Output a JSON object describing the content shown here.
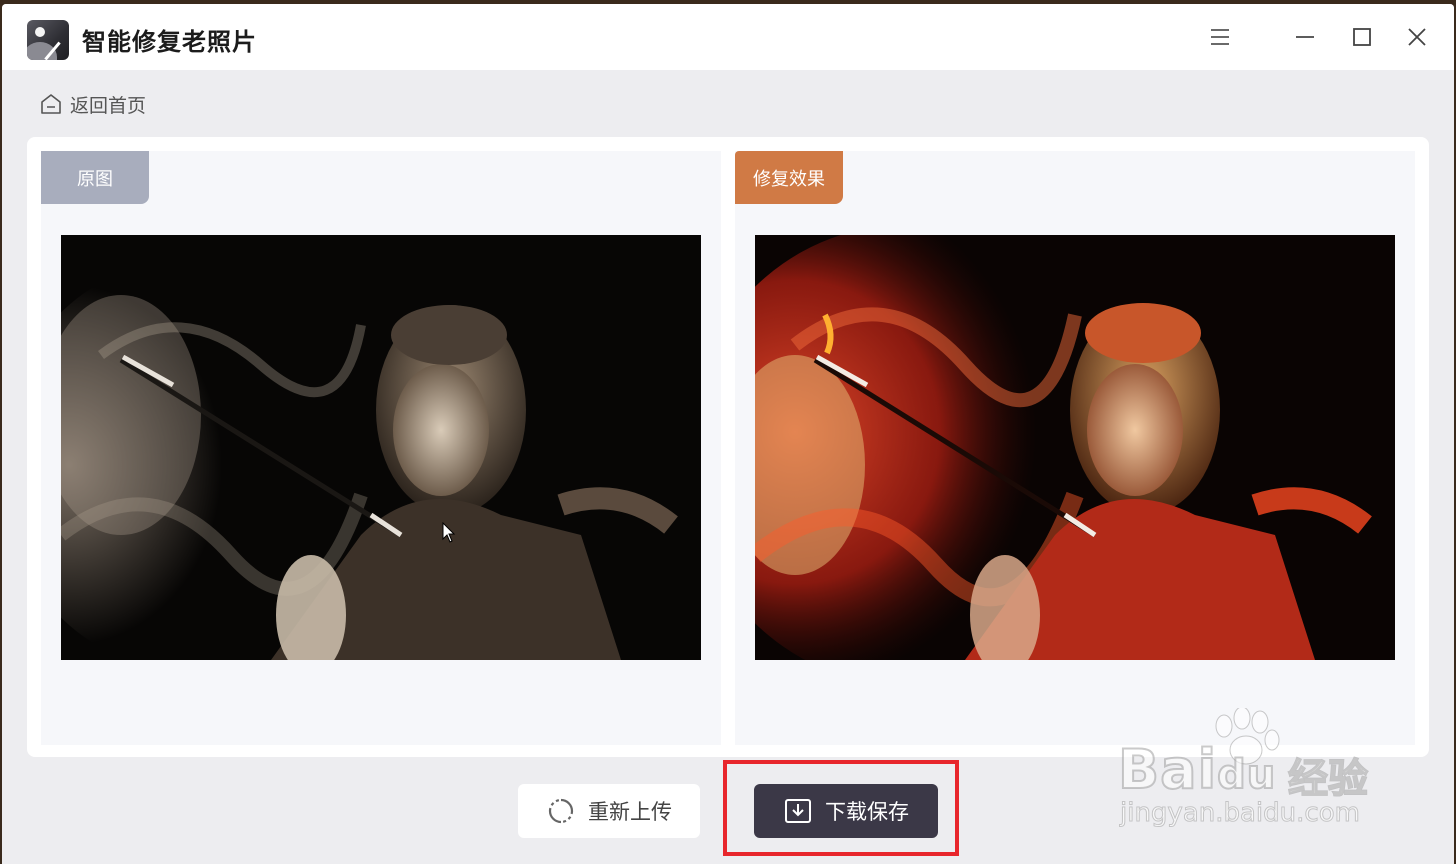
{
  "app": {
    "title": "智能修复老照片"
  },
  "nav": {
    "back_home": "返回首页"
  },
  "panes": {
    "original_label": "原图",
    "result_label": "修复效果"
  },
  "actions": {
    "reupload": "重新上传",
    "download_save": "下载保存"
  },
  "watermark": {
    "brand": "Bai",
    "brand_suffix": "du",
    "brand_cn": "经验",
    "url": "jingyan.baidu.com"
  },
  "icons": [
    "app-logo-icon",
    "menu-icon",
    "minimize-icon",
    "maximize-icon",
    "close-icon",
    "home-icon",
    "refresh-icon",
    "download-icon"
  ],
  "colors": {
    "original_tag": "#a8adbd",
    "result_tag": "#d07a45",
    "download_button": "#3b3847",
    "highlight_box": "#e8262c"
  }
}
